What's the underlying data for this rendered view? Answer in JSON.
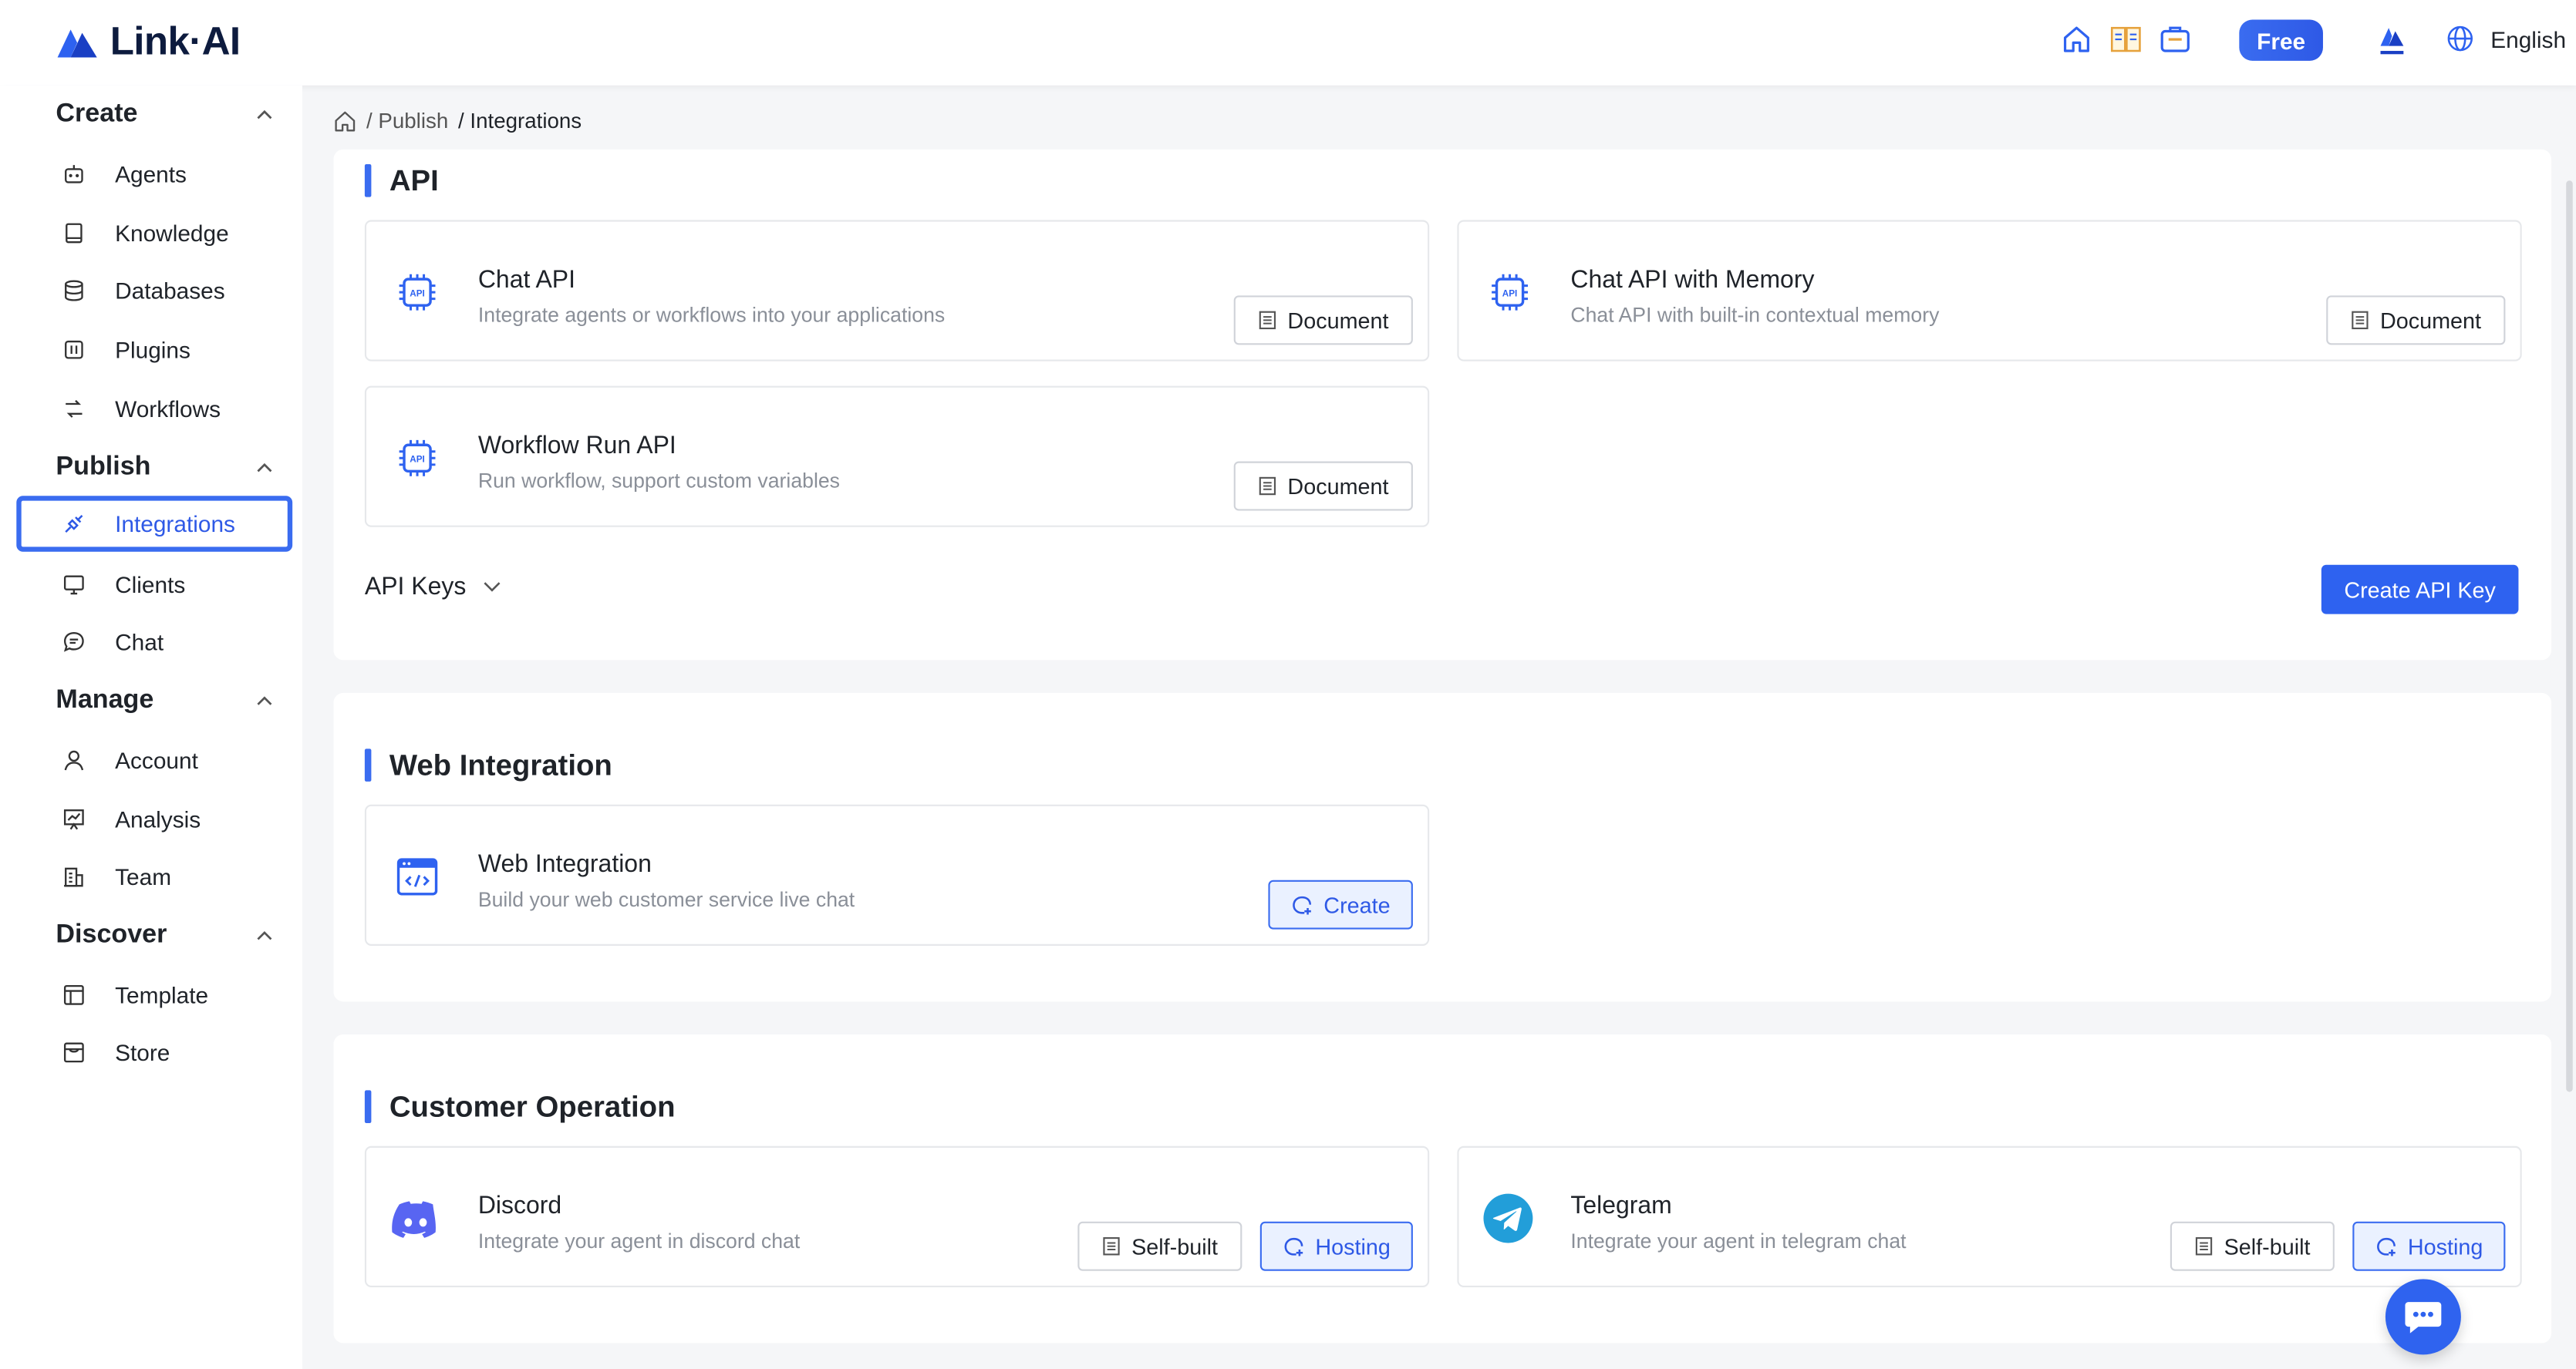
{
  "app": {
    "name": "Link·AI"
  },
  "header": {
    "plan_label": "Free",
    "language": "English"
  },
  "sidebar": {
    "sections": [
      {
        "title": "Create",
        "items": [
          "Agents",
          "Knowledge",
          "Databases",
          "Plugins",
          "Workflows"
        ]
      },
      {
        "title": "Publish",
        "items": [
          "Integrations",
          "Clients",
          "Chat"
        ]
      },
      {
        "title": "Manage",
        "items": [
          "Account",
          "Analysis",
          "Team"
        ]
      },
      {
        "title": "Discover",
        "items": [
          "Template",
          "Store"
        ]
      }
    ],
    "active_item": "Integrations"
  },
  "breadcrumb": {
    "items": [
      "/ Publish",
      "/ Integrations"
    ]
  },
  "api": {
    "title": "API",
    "cards": [
      {
        "title": "Chat API",
        "desc": "Integrate agents or workflows into your applications",
        "button": "Document"
      },
      {
        "title": "Chat API with Memory",
        "desc": "Chat API with built-in contextual memory",
        "button": "Document"
      },
      {
        "title": "Workflow Run API",
        "desc": "Run workflow, support custom variables",
        "button": "Document"
      }
    ],
    "keys_label": "API Keys",
    "create_key_label": "Create API Key"
  },
  "web": {
    "title": "Web Integration",
    "card": {
      "title": "Web Integration",
      "desc": "Build your web customer service live chat",
      "button": "Create"
    }
  },
  "customer": {
    "title": "Customer Operation",
    "cards": [
      {
        "title": "Discord",
        "desc": "Integrate your agent in discord chat",
        "btn_self": "Self-built",
        "btn_host": "Hosting"
      },
      {
        "title": "Telegram",
        "desc": "Integrate your agent in telegram chat",
        "btn_self": "Self-built",
        "btn_host": "Hosting"
      }
    ]
  },
  "colors": {
    "accent": "#2e62f0",
    "discord": "#5865F2",
    "telegram": "#229ED9"
  }
}
